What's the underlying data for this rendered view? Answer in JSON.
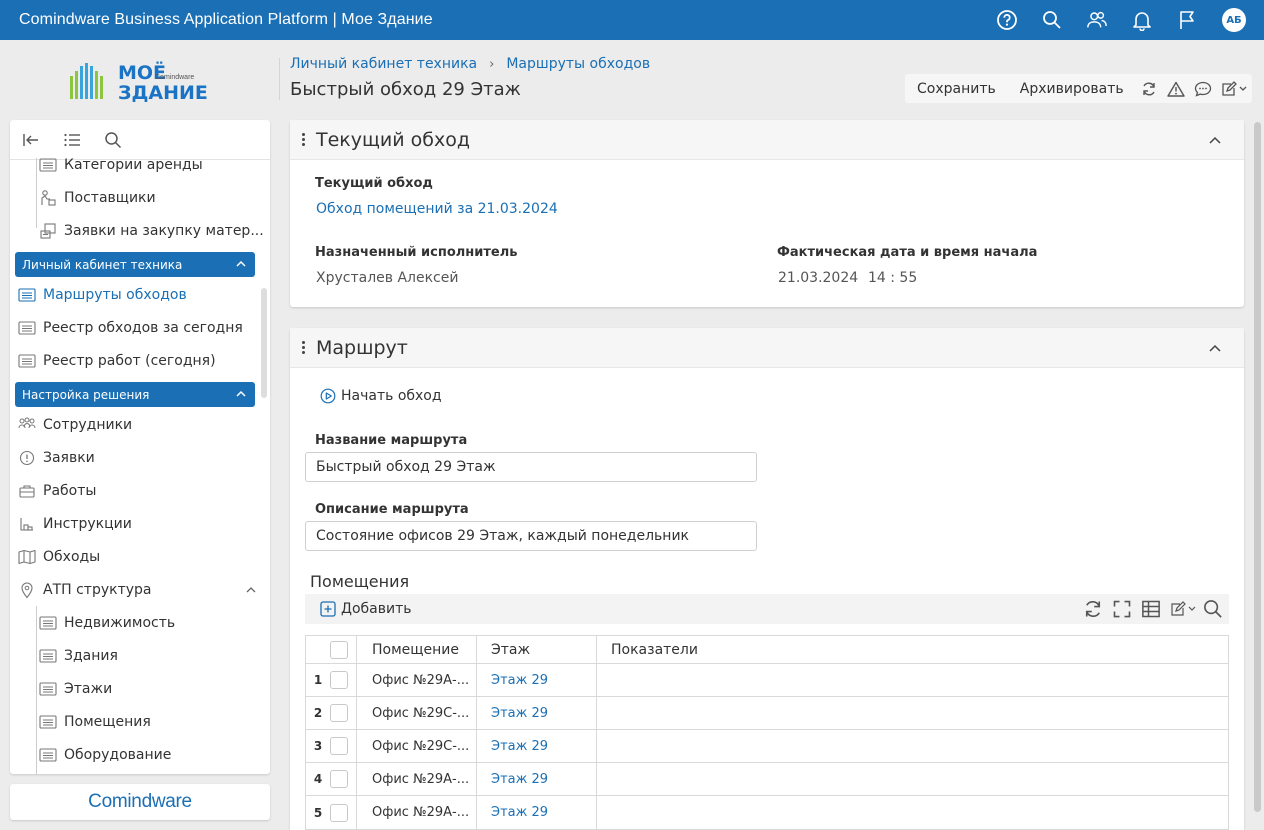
{
  "app": {
    "title": "Comindware Business Application Platform  |  Мое Здание",
    "avatar_initials": "АБ",
    "accent": "#1a6fb5",
    "top_icons": [
      "help-icon",
      "search-icon",
      "users-icon",
      "bell-icon",
      "flag-icon"
    ]
  },
  "logo": {
    "line1": "МОЁ",
    "line2": "ЗДАНИЕ",
    "brand": "Comindware"
  },
  "breadcrumb": {
    "item1": "Личный кабинет техника",
    "item2": "Маршруты обходов",
    "sep": "›"
  },
  "page_title": "Быстрый обход 29 Этаж",
  "toolbar": {
    "save": "Сохранить",
    "archive": "Архивировать"
  },
  "sidebar": {
    "items": [
      {
        "label": "Категории аренды",
        "icon": "list-icon"
      },
      {
        "label": "Поставщики",
        "icon": "supplier-icon"
      },
      {
        "label": "Заявки на закупку матер...",
        "icon": "purchase-icon"
      },
      {
        "group": "Личный кабинет техника"
      },
      {
        "label": "Маршруты обходов",
        "icon": "list-icon",
        "active": true
      },
      {
        "label": "Реестр обходов за сегодня",
        "icon": "list-icon"
      },
      {
        "label": "Реестр работ (сегодня)",
        "icon": "list-icon"
      },
      {
        "group": "Настройка решения"
      },
      {
        "label": "Сотрудники",
        "icon": "users-icon"
      },
      {
        "label": "Заявки",
        "icon": "alert-circle-icon"
      },
      {
        "label": "Работы",
        "icon": "briefcase-icon"
      },
      {
        "label": "Инструкции",
        "icon": "instruction-icon"
      },
      {
        "label": "Обходы",
        "icon": "map-icon"
      },
      {
        "label": "АТП структура",
        "icon": "pin-icon"
      },
      {
        "label": "Недвижимость",
        "icon": "list-icon"
      },
      {
        "label": "Здания",
        "icon": "list-icon"
      },
      {
        "label": "Этажи",
        "icon": "list-icon"
      },
      {
        "label": "Помещения",
        "icon": "list-icon"
      },
      {
        "label": "Оборудование",
        "icon": "list-icon"
      }
    ],
    "footer_brand": "Comindware"
  },
  "current_panel": {
    "title": "Текущий обход",
    "current_label": "Текущий обход",
    "current_value": "Обход помещений за 21.03.2024",
    "assignee_label": "Назначенный исполнитель",
    "assignee_value": "Хрусталев Алексей",
    "start_label": "Фактическая дата и время начала",
    "start_date": "21.03.2024",
    "start_time": "14 : 55"
  },
  "route_panel": {
    "title": "Маршрут",
    "start_button": "Начать обход",
    "name_label": "Название маршрута",
    "name_value": "Быстрый обход 29 Этаж",
    "desc_label": "Описание маршрута",
    "desc_value": "Состояние офисов 29 Этаж, каждый понедельник",
    "rooms_title": "Помещения",
    "add_button": "Добавить",
    "columns": [
      "Помещение",
      "Этаж",
      "Показатели"
    ],
    "rows": [
      {
        "n": "1",
        "room": "Офис №29А-...",
        "floor": "Этаж 29",
        "ind": ""
      },
      {
        "n": "2",
        "room": "Офис №29С-...",
        "floor": "Этаж 29",
        "ind": ""
      },
      {
        "n": "3",
        "room": "Офис №29С-...",
        "floor": "Этаж 29",
        "ind": ""
      },
      {
        "n": "4",
        "room": "Офис №29А-...",
        "floor": "Этаж 29",
        "ind": ""
      },
      {
        "n": "5",
        "room": "Офис №29А-...",
        "floor": "Этаж 29",
        "ind": ""
      }
    ]
  }
}
